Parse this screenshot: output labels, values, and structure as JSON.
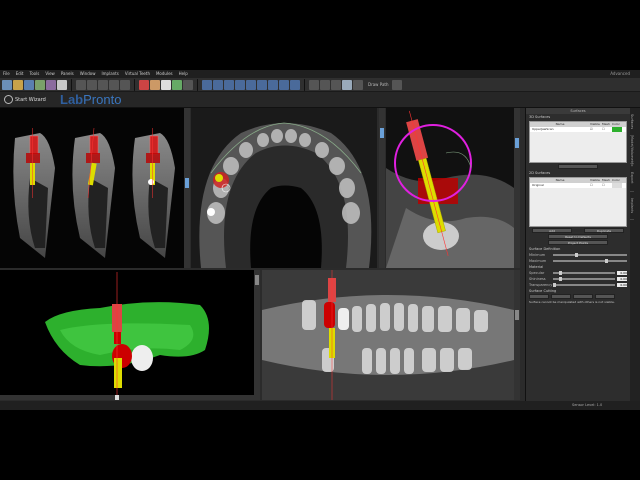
{
  "menu": [
    "File",
    "Edit",
    "Tools",
    "View",
    "Panels",
    "Window",
    "Implants",
    "Virtual Teeth",
    "Modules",
    "Help"
  ],
  "menu_right": "Advanced",
  "toolbar": {
    "draw_label": "Draw Path"
  },
  "wizard": {
    "label": "Start Wizard"
  },
  "logo": {
    "part1": "Lab",
    "part2": "Pronto"
  },
  "sidebar": {
    "title": "Surfaces",
    "section3d": "3D Surfaces",
    "table_headers": [
      "Name",
      "Visible",
      "Mesh",
      "Color"
    ],
    "surface_row": "UpperJawScan",
    "section2d": "2D Surfaces",
    "row2d": "Original",
    "btn_add": "Add",
    "btn_duplicate": "Duplicate",
    "btn_reset": "Reset to Defaults",
    "btn_project": "Project Points",
    "surface_def": "Surface Definition",
    "minimum": "Minimum",
    "maximum": "Maximum",
    "material": "Material",
    "specular": "Specular",
    "shininess": "Shininess",
    "transparency": "Transparency",
    "specular_val": "0.00",
    "shininess_val": "0.00",
    "transparency_val": "0.00",
    "surface_cutting": "Surface Cutting",
    "cutting_note": "Surface cannot be manipulated with others is not visible."
  },
  "vtabs": [
    "Surfaces",
    "Model/Volumetric",
    "Export",
    "Implants"
  ],
  "status": {
    "text": "Sensor Level: 1.0"
  }
}
